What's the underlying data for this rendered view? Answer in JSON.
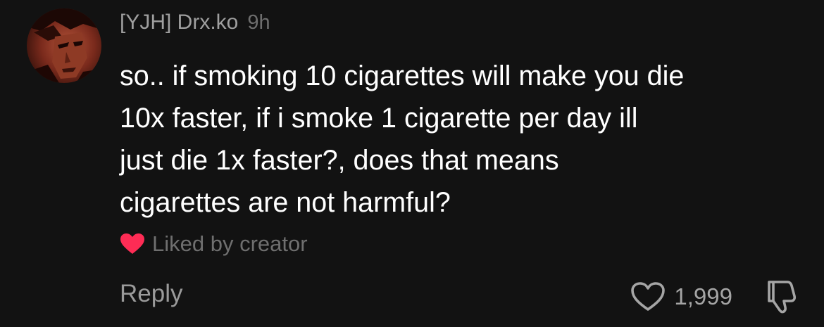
{
  "comment": {
    "username": "[YJH] Drx.ko",
    "timestamp": "9h",
    "avatar_icon": "anime-character-avatar",
    "text_lines": [
      "so.. if smoking 10 cigarettes will make you die",
      "10x faster, if i smoke 1 cigarette per day ill",
      "just die 1x faster?, does that means",
      "cigarettes are not harmful?"
    ],
    "liked_by_creator_label": "Liked by creator",
    "liked_heart_icon": "heart-icon",
    "liked_heart_color": "#fe2c55",
    "reply_label": "Reply",
    "like_count": "1,999",
    "like_icon": "heart-outline-icon",
    "dislike_icon": "thumbs-down-icon"
  },
  "colors": {
    "background": "#121212",
    "text_primary": "#ffffff",
    "text_secondary": "#9f9f9f",
    "text_muted": "#6e6e6e"
  }
}
